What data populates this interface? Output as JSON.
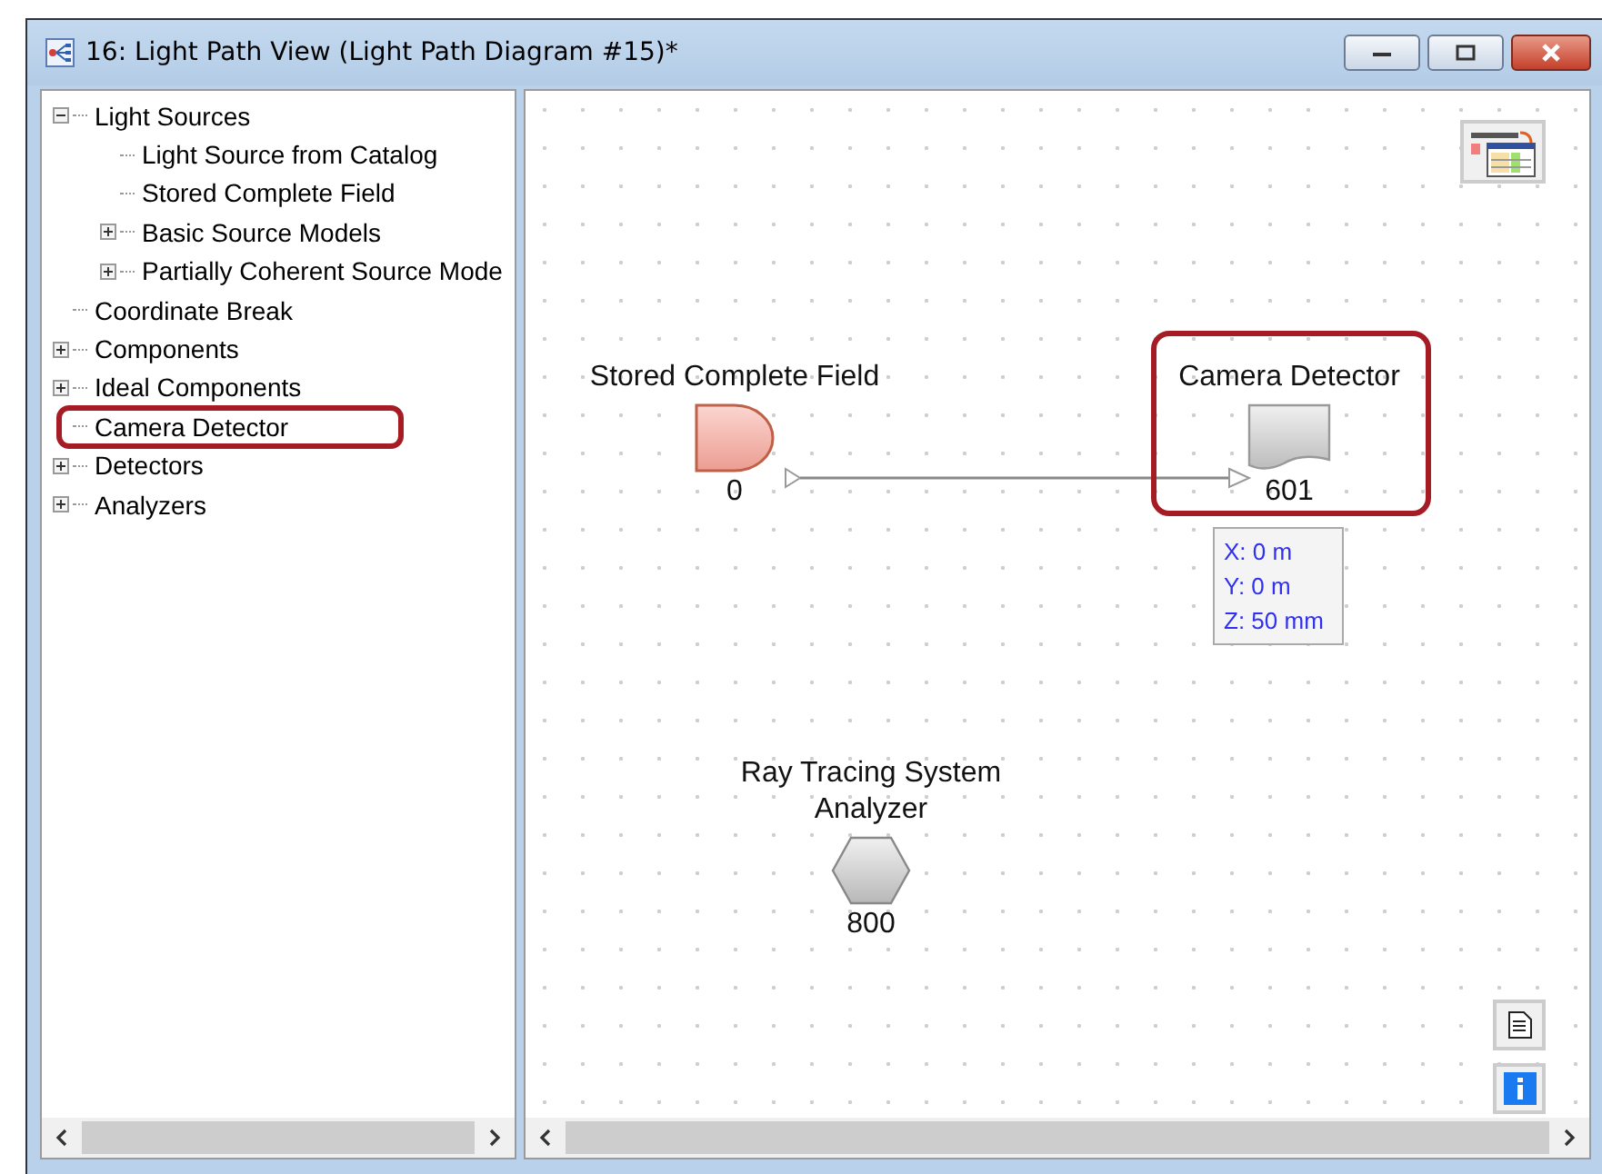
{
  "window": {
    "title": "16: Light Path View (Light Path Diagram #15)*"
  },
  "tree": {
    "items": [
      {
        "label": "Light Sources",
        "kind": "group",
        "expanded": true,
        "highlighted": false,
        "children": [
          {
            "label": "Light Source from Catalog",
            "kind": "item",
            "highlighted": false
          },
          {
            "label": "Stored Complete Field",
            "kind": "item",
            "highlighted": false
          },
          {
            "label": "Basic Source Models",
            "kind": "group",
            "expanded": false,
            "highlighted": false
          },
          {
            "label": "Partially Coherent Source Mode",
            "kind": "group",
            "expanded": false,
            "highlighted": false
          }
        ]
      },
      {
        "label": "Coordinate Break",
        "kind": "item",
        "highlighted": false
      },
      {
        "label": "Components",
        "kind": "group",
        "expanded": false,
        "highlighted": false
      },
      {
        "label": "Ideal Components",
        "kind": "group",
        "expanded": false,
        "highlighted": false
      },
      {
        "label": "Camera Detector",
        "kind": "item",
        "highlighted": true
      },
      {
        "label": "Detectors",
        "kind": "group",
        "expanded": false,
        "highlighted": false
      },
      {
        "label": "Analyzers",
        "kind": "group",
        "expanded": false,
        "highlighted": false
      }
    ]
  },
  "diagram": {
    "nodes": [
      {
        "kind": "source",
        "label": "Stored Complete Field",
        "index": "0",
        "highlighted": false
      },
      {
        "kind": "detector",
        "label": "Camera Detector",
        "index": "601",
        "highlighted": true,
        "tooltip": [
          "X: 0 m",
          "Y: 0 m",
          "Z: 50 mm"
        ]
      },
      {
        "kind": "analyzer",
        "label": "Ray Tracing System Analyzer",
        "index": "800",
        "highlighted": false
      }
    ]
  }
}
